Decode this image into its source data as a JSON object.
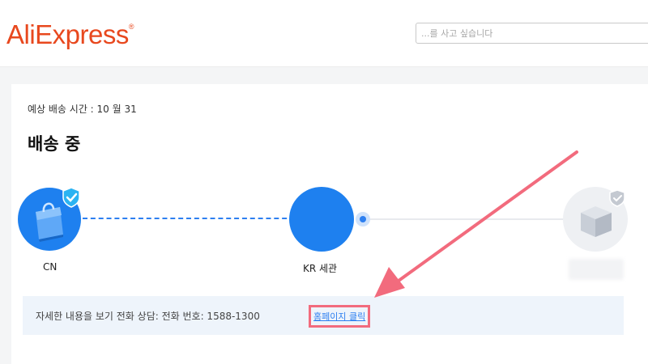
{
  "header": {
    "logo_text": "AliExpress",
    "logo_mark": "®",
    "search_placeholder": "...를 사고 싶습니다"
  },
  "tracking": {
    "eta_text": "예상 배송 시간 : 10 월 31",
    "status_title": "배송 중",
    "nodes": [
      {
        "label": "CN",
        "state": "completed",
        "icon": "shopping-bag-icon"
      },
      {
        "label": "KR 세관",
        "state": "current",
        "icon": "customs-icon"
      },
      {
        "label": "",
        "state": "pending",
        "icon": "package-icon"
      }
    ]
  },
  "info": {
    "text": "자세한 내용을 보기 전화 상담: 전화 번호: 1588-1300",
    "link_label": "홈페이지 클릭"
  },
  "colors": {
    "brand": "#e8481e",
    "progress_blue": "#1e80ef",
    "highlight_red": "#f26b7d",
    "info_bg": "#eef4fb"
  }
}
